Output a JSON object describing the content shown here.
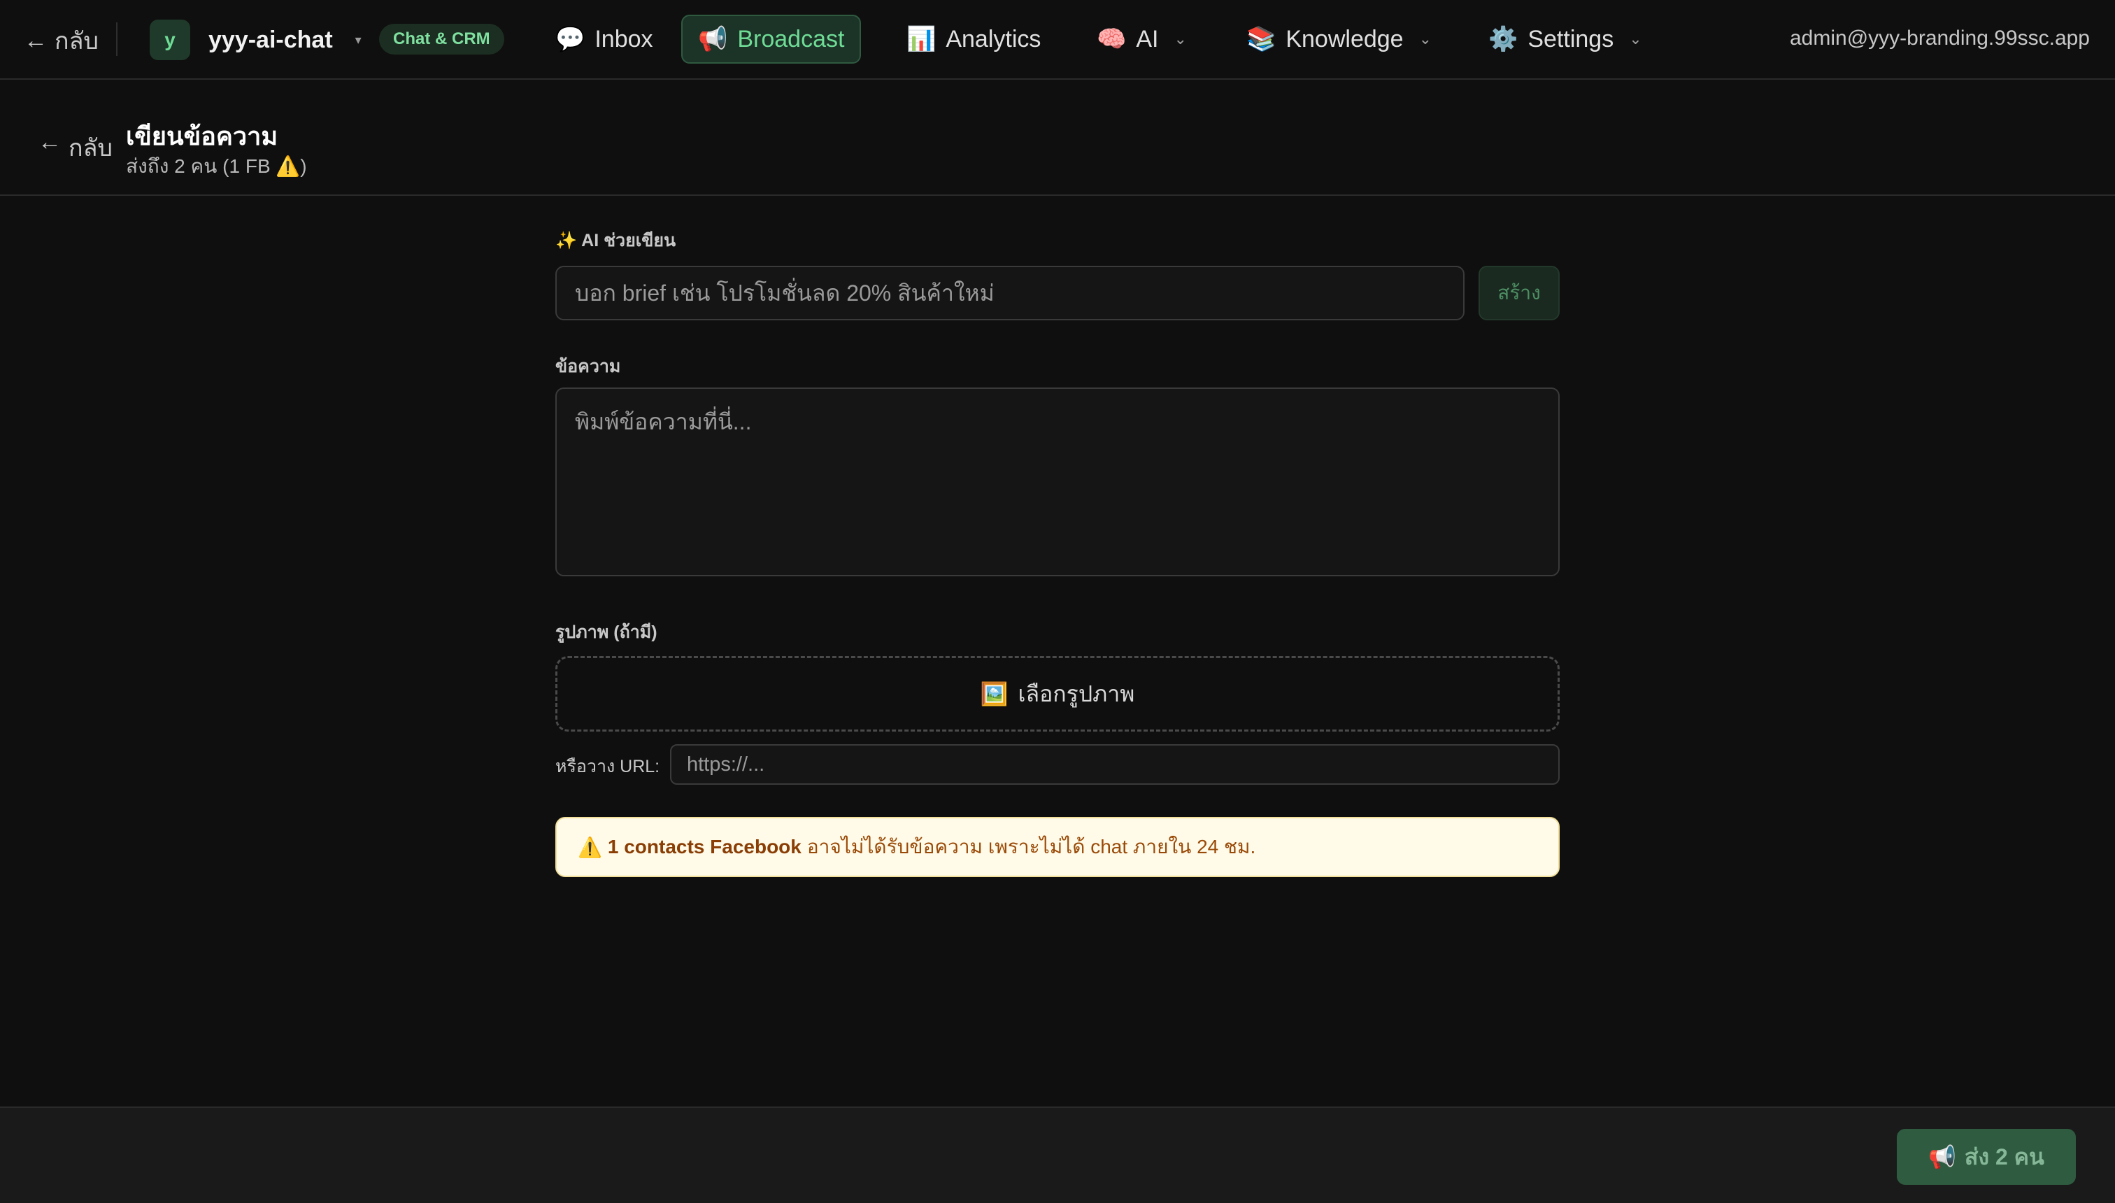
{
  "topbar": {
    "back_label": "กลับ",
    "workspace": {
      "avatar": "y",
      "name": "yyy-ai-chat",
      "caret": "▾"
    },
    "badge": "Chat & CRM",
    "nav": [
      {
        "icon": "💬",
        "label": "Inbox",
        "active": false
      },
      {
        "icon": "📢",
        "label": "Broadcast",
        "active": true
      },
      {
        "icon": "📊",
        "label": "Analytics",
        "active": false
      },
      {
        "icon": "🧠",
        "label": "AI",
        "active": false,
        "has_menu": true
      },
      {
        "icon": "📚",
        "label": "Knowledge",
        "active": false,
        "has_menu": true
      },
      {
        "icon": "⚙️",
        "label": "Settings",
        "active": false,
        "has_menu": true
      }
    ],
    "user_email": "admin@yyy-branding.99ssc.app"
  },
  "page": {
    "back_label": "กลับ",
    "title": "เขียนข้อความ",
    "caption": "ส่งถึง 2 คน (1 FB ⚠️)"
  },
  "form": {
    "ai_label": "✨ AI ช่วยเขียน",
    "ai_placeholder": "บอก brief เช่น โปรโมชั่นลด 20% สินค้าใหม่",
    "generate_label": "สร้าง",
    "message_label": "ข้อความ",
    "message_placeholder": "พิมพ์ข้อความที่นี่...",
    "image_label": "รูปภาพ (ถ้ามี)",
    "choose_image_icon": "🖼️",
    "choose_image_label": "เลือกรูปภาพ",
    "url_label": "หรือวาง URL:",
    "url_placeholder": "https://..."
  },
  "warning": {
    "icon": "⚠️",
    "emphasis": "1 contacts Facebook",
    "text": "อาจไม่ได้รับข้อความ เพราะไม่ได้ chat ภายใน 24 ชม."
  },
  "footer": {
    "send_icon": "📢",
    "send_label": "ส่ง 2 คน"
  },
  "colors": {
    "accent": "#6fdc96",
    "background": "#0f0f0f",
    "warning_bg": "#fffbe8",
    "warning_text": "#9a4a08"
  }
}
